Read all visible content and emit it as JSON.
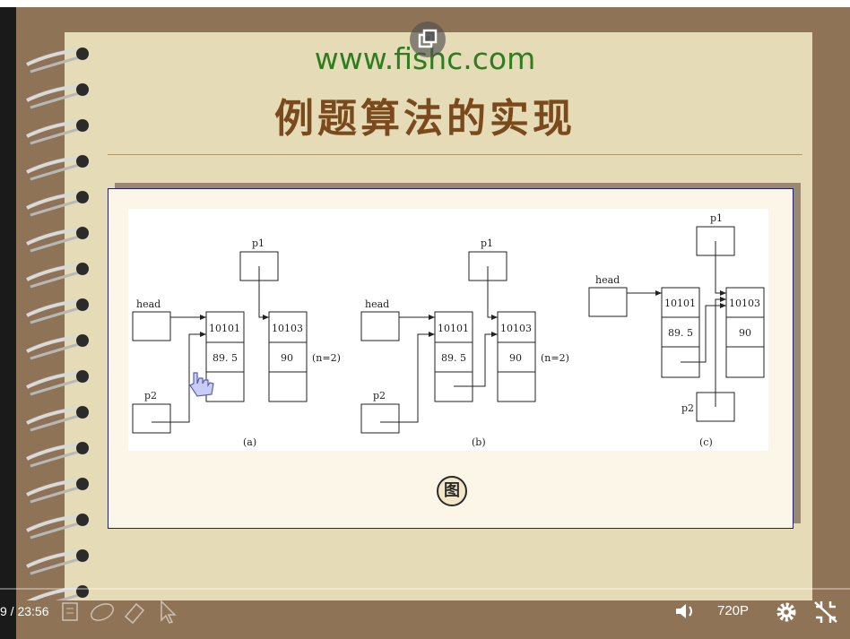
{
  "slide": {
    "url": "www.fishc.com",
    "title": "例题算法的实现",
    "figure_label": "图"
  },
  "diagram": {
    "a": {
      "caption": "(a)",
      "head": "head",
      "p1": "p1",
      "p2": "p2",
      "node1": {
        "num": "10101",
        "score": "89. 5"
      },
      "node2": {
        "num": "10103",
        "score": "90"
      },
      "n_note": "(n=2)"
    },
    "b": {
      "caption": "(b)",
      "head": "head",
      "p1": "p1",
      "p2": "p2",
      "node1": {
        "num": "10101",
        "score": "89. 5"
      },
      "node2": {
        "num": "10103",
        "score": "90"
      },
      "n_note": "(n=2)"
    },
    "c": {
      "caption": "(c)",
      "head": "head",
      "p1": "p1",
      "p2": "p2",
      "node1": {
        "num": "10101",
        "score": "89. 5"
      },
      "node2": {
        "num": "10103",
        "score": "90"
      }
    }
  },
  "player": {
    "time": "9 / 23:56",
    "quality": "720P",
    "icons": [
      "popout-icon",
      "notes-icon",
      "draw-icon",
      "eraser-icon",
      "pointer-icon",
      "volume-icon",
      "settings-icon",
      "fullscreen-exit-icon"
    ]
  },
  "colors": {
    "paper": "#e5dbb7",
    "board": "#8f7356",
    "url": "#2e7d1e",
    "title": "#7a4a1c"
  }
}
